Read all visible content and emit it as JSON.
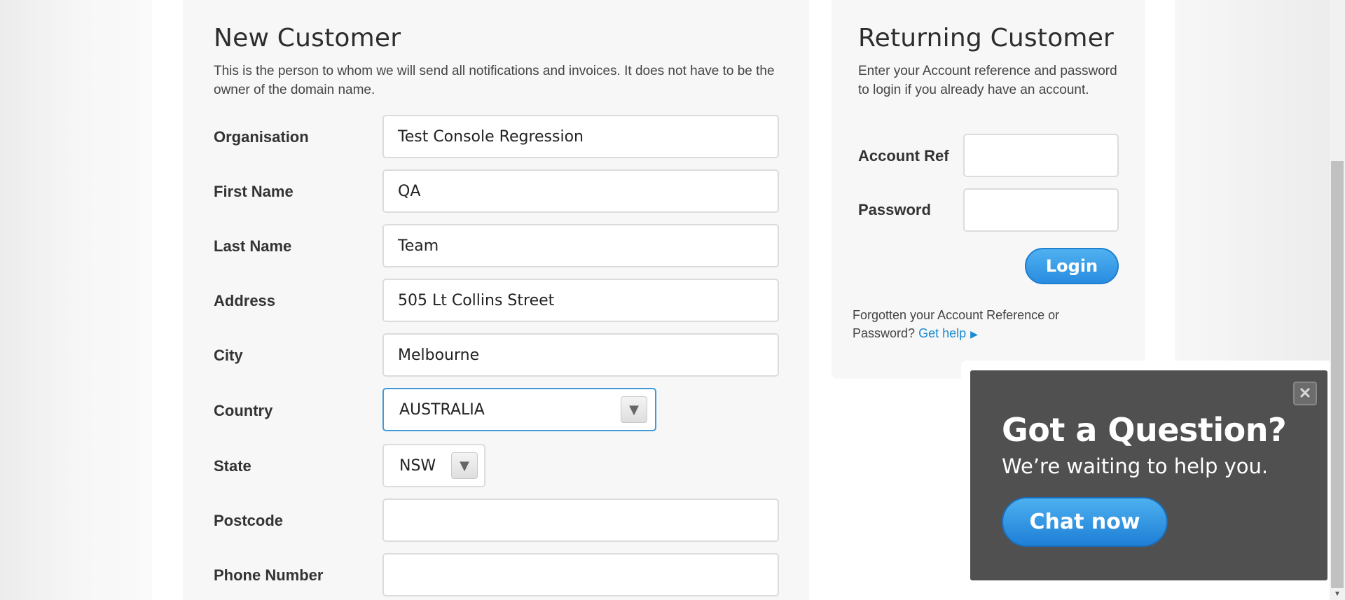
{
  "new_customer": {
    "title": "New Customer",
    "description": "This is the person to whom we will send all notifications and invoices. It does not have to be the owner of the domain name.",
    "fields": [
      {
        "label": "Organisation",
        "value": "Test Console Regression"
      },
      {
        "label": "First Name",
        "value": "QA"
      },
      {
        "label": "Last Name",
        "value": "Team"
      },
      {
        "label": "Address",
        "value": "505 Lt Collins Street"
      },
      {
        "label": "City",
        "value": "Melbourne"
      },
      {
        "label": "Country",
        "value": "AUSTRALIA"
      },
      {
        "label": "State",
        "value": "NSW"
      },
      {
        "label": "Postcode",
        "value": ""
      },
      {
        "label": "Phone Number",
        "value": ""
      }
    ]
  },
  "returning_customer": {
    "title": "Returning Customer",
    "description": "Enter your Account reference and password to login if you already have an account.",
    "account_ref_label": "Account Ref",
    "account_ref_value": "",
    "password_label": "Password",
    "password_value": "",
    "login_label": "Login",
    "help_text": "Forgotten your Account Reference or Password?",
    "help_link": "Get help"
  },
  "chat": {
    "title": "Got a Question?",
    "subtitle": "We’re waiting to help you.",
    "button_label": "Chat now",
    "close_icon": "close-icon"
  },
  "colors": {
    "accent": "#2a8ce0",
    "focus_border": "#3f9ad7",
    "chat_bg": "#505050"
  }
}
